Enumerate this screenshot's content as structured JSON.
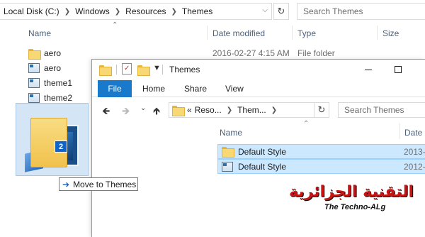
{
  "back_window": {
    "address": {
      "crumbs": [
        "Local Disk (C:)",
        "Windows",
        "Resources",
        "Themes"
      ]
    },
    "search_placeholder": "Search Themes",
    "columns": [
      "Name",
      "Date modified",
      "Type",
      "Size"
    ],
    "files": [
      {
        "name": "aero",
        "icon": "folder-icon",
        "date": "2016-02-27 4:15 AM",
        "type": "File folder"
      },
      {
        "name": "aero",
        "icon": "theme-file-icon"
      },
      {
        "name": "theme1",
        "icon": "theme-file-icon"
      },
      {
        "name": "theme2",
        "icon": "theme-file-icon"
      }
    ]
  },
  "drag": {
    "badge_count": "2",
    "tooltip": "Move to Themes"
  },
  "front_window": {
    "title": "Themes",
    "ribbon_tabs": [
      "File",
      "Home",
      "Share",
      "View"
    ],
    "address": {
      "prefix": "«",
      "crumbs": [
        "Reso...",
        "Them..."
      ]
    },
    "search_placeholder": "Search Themes",
    "columns": [
      "Name",
      "Date"
    ],
    "files": [
      {
        "name": "Default Style",
        "icon": "folder-icon",
        "date": "2013-"
      },
      {
        "name": "Default Style",
        "icon": "theme-file-icon",
        "date": "2012-"
      }
    ]
  },
  "watermark": {
    "arabic": "التقنية الجزائرية",
    "latin": "The Techno-ALg"
  },
  "colors": {
    "accent": "#1979ca",
    "selection": "#cce8ff",
    "selection_border": "#99d1ff",
    "column_header": "#4c607a",
    "watermark_red": "#c81414"
  }
}
